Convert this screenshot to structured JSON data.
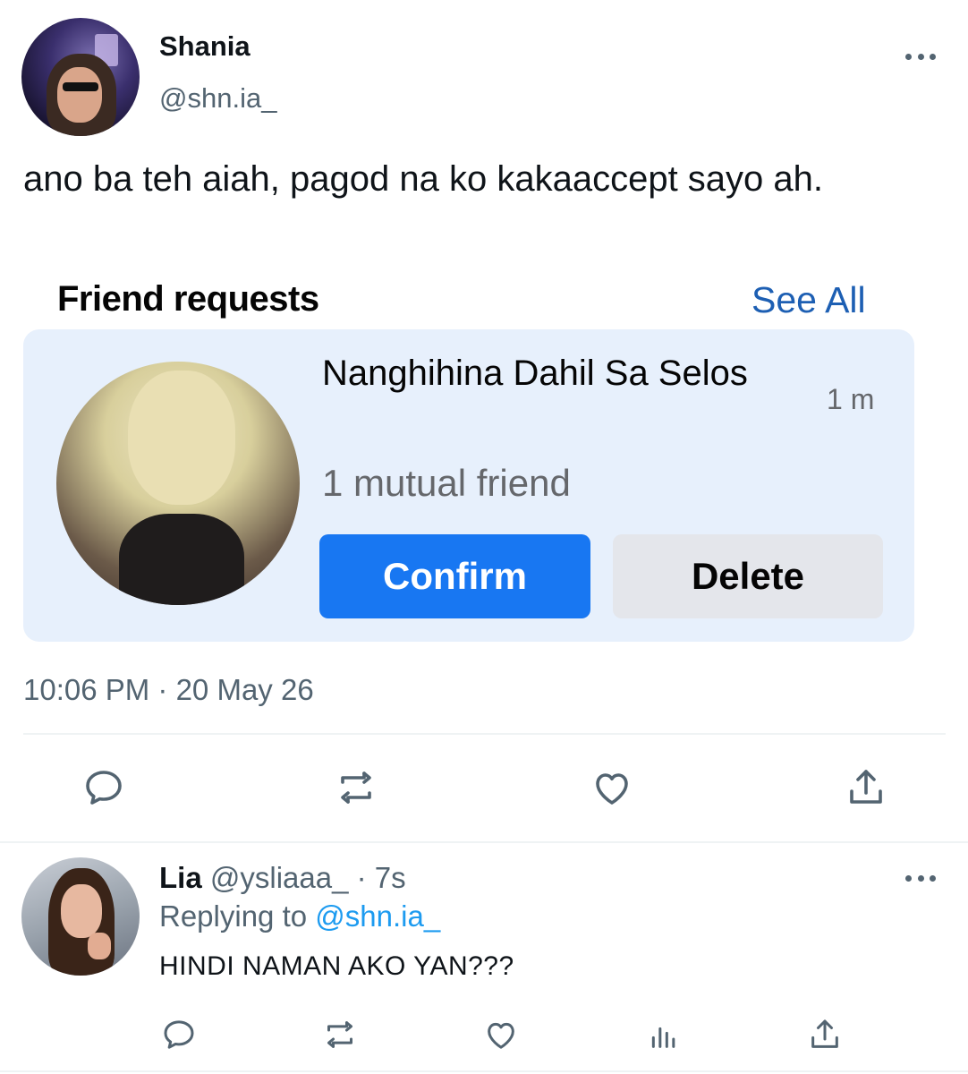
{
  "tweet": {
    "author_name": "Shania",
    "author_handle": "@shn.ia_",
    "text": "ano ba teh aiah, pagod na ko kakaaccept sayo ah.",
    "timestamp": "10:06 PM · 20 May 26"
  },
  "embed": {
    "title": "Friend requests",
    "see_all": "See All",
    "request": {
      "name": "Nanghihina Dahil Sa Selos",
      "time": "1 m",
      "mutual": "1 mutual friend",
      "confirm_label": "Confirm",
      "delete_label": "Delete",
      "confirm_color": "#1877f2",
      "delete_color": "#e4e6eb"
    }
  },
  "reply": {
    "author_name": "Lia",
    "author_handle": "@ysliaaa_",
    "time": "· 7s",
    "replying_prefix": "Replying to",
    "replying_to": "@shn.ia_",
    "text": "HINDI NAMAN AKO YAN???"
  },
  "icons": [
    "more-icon",
    "reply-icon",
    "retweet-icon",
    "like-icon",
    "share-icon",
    "analytics-icon"
  ],
  "colors": {
    "accent": "#1d9bf0",
    "secondary_text": "#536471"
  }
}
